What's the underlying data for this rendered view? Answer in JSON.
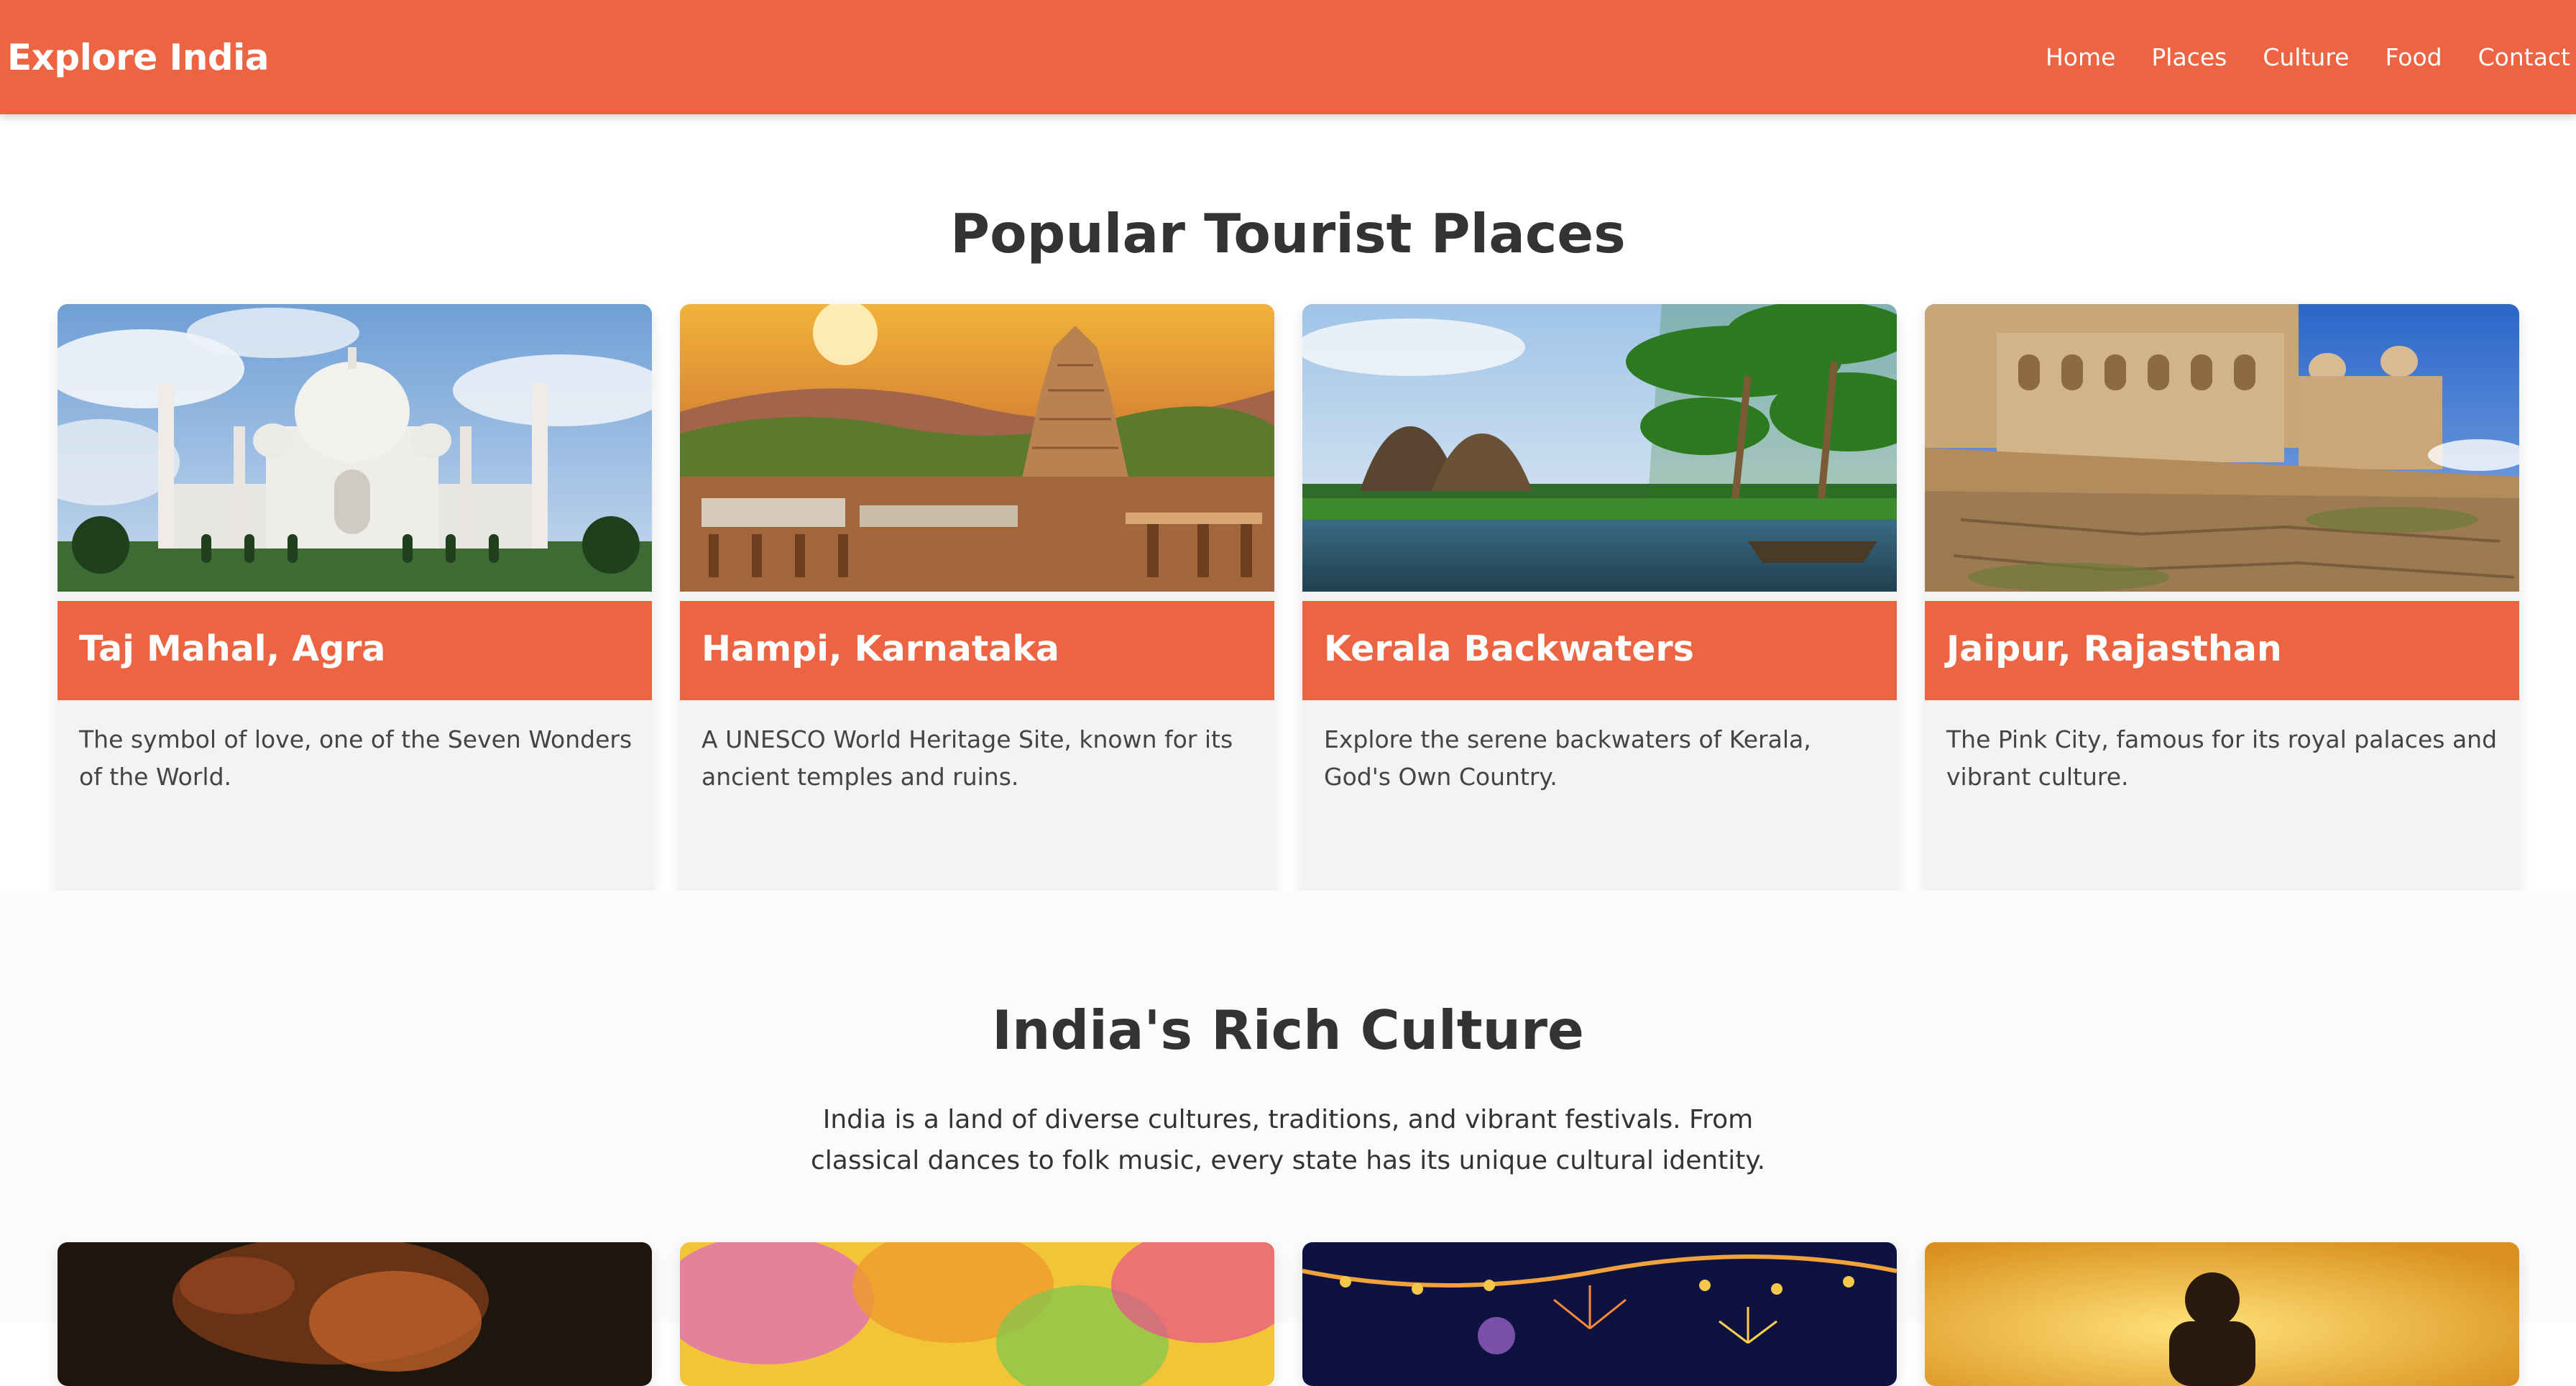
{
  "nav": {
    "brand": "Explore India",
    "links": [
      "Home",
      "Places",
      "Culture",
      "Food",
      "Contact"
    ]
  },
  "places": {
    "title": "Popular Tourist Places",
    "cards": [
      {
        "title": "Taj Mahal, Agra",
        "description": "The symbol of love, one of the Seven Wonders of the World."
      },
      {
        "title": "Hampi, Karnataka",
        "description": "A UNESCO World Heritage Site, known for its ancient temples and ruins."
      },
      {
        "title": "Kerala Backwaters",
        "description": "Explore the serene backwaters of Kerala, God's Own Country."
      },
      {
        "title": "Jaipur, Rajasthan",
        "description": "The Pink City, famous for its royal palaces and vibrant culture."
      }
    ]
  },
  "culture": {
    "title": "India's Rich Culture",
    "description": "India is a land of diverse cultures, traditions, and vibrant festivals. From classical dances to folk music, every state has its unique cultural identity."
  },
  "colors": {
    "accent": "#ed6442",
    "heading": "#333333",
    "card_bg": "#f3f3f3"
  },
  "images": [
    "taj-mahal-photo",
    "hampi-temple-photo",
    "kerala-backwaters-photo",
    "jaipur-fort-photo",
    "dance-photo",
    "holi-colors-photo",
    "diwali-fireworks-photo",
    "yoga-sunset-photo"
  ]
}
